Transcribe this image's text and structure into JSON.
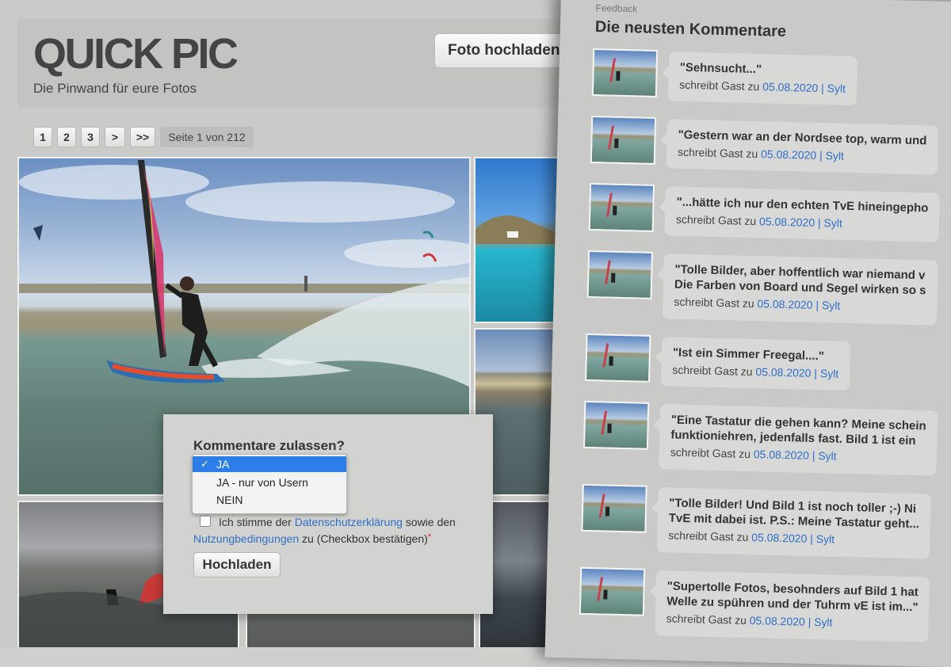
{
  "header": {
    "title": "QUICK PIC",
    "subtitle": "Die Pinwand für eure Fotos",
    "upload_label": "Foto hochladen"
  },
  "pagination": {
    "pages": [
      "1",
      "2",
      "3"
    ],
    "next": ">",
    "last": ">>",
    "info": "Seite 1 von 212"
  },
  "form": {
    "comments_label": "Kommentare zulassen?",
    "options": [
      "JA",
      "JA - nur von Usern",
      "NEIN"
    ],
    "selected_check": "✓",
    "terms_text_1": "Ich stimme der",
    "privacy_link": "Datenschutzerklärung",
    "terms_text_2": "sowie den",
    "terms_link": "Nutzungbedingungen",
    "terms_text_3": "zu (Checkbox bestätigen)",
    "required_mark": "*",
    "submit_label": "Hochladen"
  },
  "feedback": {
    "tab_label": "Feedback",
    "heading": "Die neusten Kommentare",
    "comments": [
      {
        "line1": "\"Sehnsucht...\"",
        "line2": "",
        "author_prefix": "schreibt Gast zu",
        "date": "05.08.2020",
        "location": "| Sylt"
      },
      {
        "line1": "\"Gestern war an der Nordsee top, warm und",
        "line2": "",
        "author_prefix": "schreibt Gast zu",
        "date": "05.08.2020",
        "location": "| Sylt"
      },
      {
        "line1": "\"...hätte ich nur den echten TvE hineingepho",
        "line2": "",
        "author_prefix": "schreibt Gast zu",
        "date": "05.08.2020",
        "location": "| Sylt"
      },
      {
        "line1": "\"Tolle Bilder, aber hoffentlich war niemand v",
        "line2": "Die Farben von Board und Segel wirken so s",
        "author_prefix": "schreibt Gast zu",
        "date": "05.08.2020",
        "location": "| Sylt"
      },
      {
        "line1": "\"Ist ein Simmer Freegal....\"",
        "line2": "",
        "author_prefix": "schreibt Gast zu",
        "date": "05.08.2020",
        "location": "| Sylt"
      },
      {
        "line1": "\"Eine Tastatur die gehen kann? Meine schein",
        "line2": "funktioniehren, jedenfalls fast. Bild 1 ist ein",
        "author_prefix": "schreibt Gast zu",
        "date": "05.08.2020",
        "location": "| Sylt"
      },
      {
        "line1": "\"Tolle Bilder! Und Bild 1 ist noch toller ;-) Ni",
        "line2": "TvE mit dabei ist. P.S.: Meine Tastatur geht...",
        "author_prefix": "schreibt Gast zu",
        "date": "05.08.2020",
        "location": "| Sylt"
      },
      {
        "line1": "\"Supertolle Fotos, besohnders auf Bild 1 hat",
        "line2": "Welle zu spühren und der Tuhrm vE ist im...\"",
        "author_prefix": "schreibt Gast zu",
        "date": "05.08.2020",
        "location": "| Sylt"
      }
    ]
  },
  "colors": {
    "link": "#2e6fc9",
    "selected_option": "#2d7ee8",
    "background": "#cacac8"
  }
}
